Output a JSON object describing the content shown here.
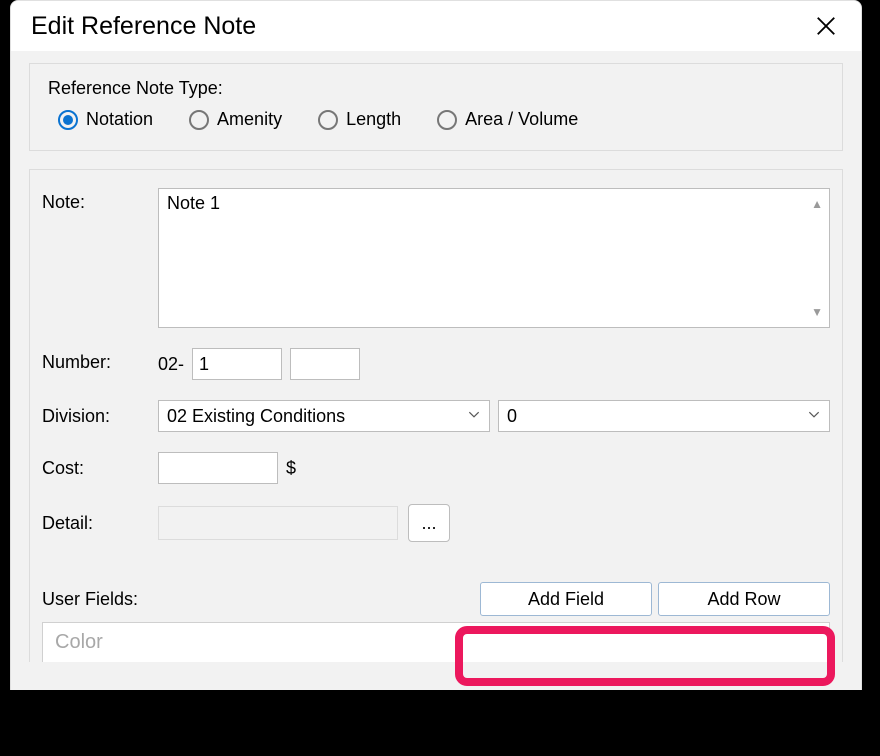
{
  "title": "Edit Reference Note",
  "panel": {
    "heading": "Reference Note Type:",
    "options": [
      {
        "label": "Notation",
        "selected": true
      },
      {
        "label": "Amenity",
        "selected": false
      },
      {
        "label": "Length",
        "selected": false
      },
      {
        "label": "Area / Volume",
        "selected": false
      }
    ]
  },
  "note": {
    "label": "Note:",
    "value": "Note 1"
  },
  "number": {
    "label": "Number:",
    "prefix": "02-",
    "value1": "1",
    "value2": ""
  },
  "division": {
    "label": "Division:",
    "selected": "02  Existing Conditions",
    "secondary_selected": "0"
  },
  "cost": {
    "label": "Cost:",
    "value": "",
    "suffix": "$"
  },
  "detail": {
    "label": "Detail:",
    "value": "",
    "browse": "..."
  },
  "user_fields": {
    "label": "User Fields:",
    "add_field": "Add Field",
    "add_row": "Add Row",
    "columns": [
      "Color"
    ]
  }
}
